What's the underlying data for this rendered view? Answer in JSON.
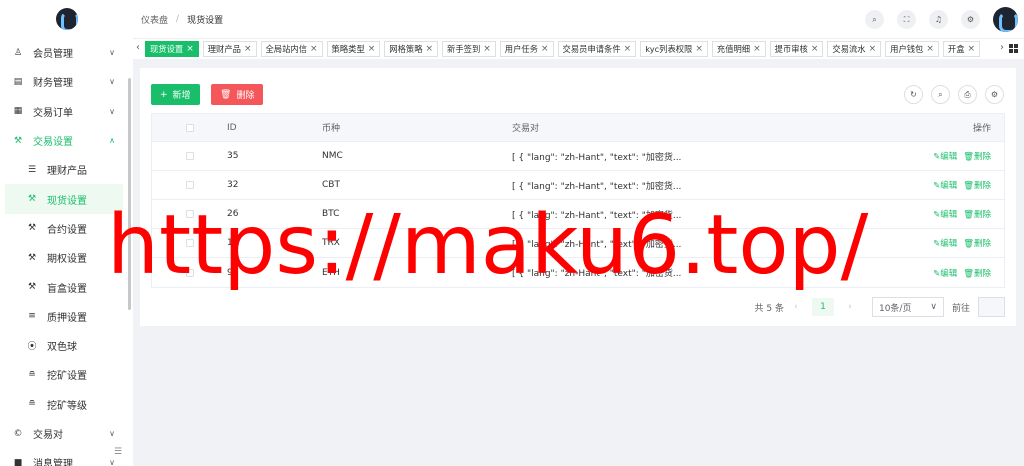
{
  "sidebar": {
    "logo": "logo-icon",
    "items": [
      {
        "icon": "user-icon",
        "glyph": "♙",
        "label": "会员管理",
        "arrow": "∨",
        "state": "closed",
        "sub": false
      },
      {
        "icon": "finance-icon",
        "glyph": "▤",
        "label": "财务管理",
        "arrow": "∨",
        "state": "closed",
        "sub": false
      },
      {
        "icon": "order-icon",
        "glyph": "▦",
        "label": "交易订单",
        "arrow": "∨",
        "state": "closed",
        "sub": false
      },
      {
        "icon": "wrench-icon",
        "glyph": "⚒",
        "label": "交易设置",
        "arrow": "∧",
        "state": "open",
        "sub": false
      },
      {
        "icon": "list-icon",
        "glyph": "☰",
        "label": "理财产品",
        "arrow": "",
        "state": "",
        "sub": true
      },
      {
        "icon": "wrench-icon",
        "glyph": "⚒",
        "label": "现货设置",
        "arrow": "",
        "state": "active",
        "sub": true
      },
      {
        "icon": "wrench-icon",
        "glyph": "⚒",
        "label": "合约设置",
        "arrow": "",
        "state": "",
        "sub": true
      },
      {
        "icon": "wrench-icon",
        "glyph": "⚒",
        "label": "期权设置",
        "arrow": "",
        "state": "",
        "sub": true
      },
      {
        "icon": "wrench-icon",
        "glyph": "⚒",
        "label": "盲盒设置",
        "arrow": "",
        "state": "",
        "sub": true
      },
      {
        "icon": "list-icon",
        "glyph": "≡",
        "label": "质押设置",
        "arrow": "",
        "state": "",
        "sub": true
      },
      {
        "icon": "target-icon",
        "glyph": "⦿",
        "label": "双色球",
        "arrow": "",
        "state": "",
        "sub": true
      },
      {
        "icon": "filter-icon",
        "glyph": "≘",
        "label": "挖矿设置",
        "arrow": "",
        "state": "",
        "sub": true
      },
      {
        "icon": "filter-icon",
        "glyph": "≘",
        "label": "挖矿等级",
        "arrow": "",
        "state": "",
        "sub": true
      },
      {
        "icon": "copyright-icon",
        "glyph": "©",
        "label": "交易对",
        "arrow": "∨",
        "state": "closed",
        "sub": false
      },
      {
        "icon": "message-icon",
        "glyph": "■",
        "label": "消息管理",
        "arrow": "∨",
        "state": "closed",
        "sub": false
      }
    ],
    "collapse_glyph": "☰"
  },
  "header": {
    "breadcrumb": [
      "仪表盘",
      "现货设置"
    ],
    "breadcrumb_sep": "/",
    "icons": [
      {
        "name": "search-icon",
        "glyph": "⌕"
      },
      {
        "name": "fullscreen-icon",
        "glyph": "⛶"
      },
      {
        "name": "bell-icon",
        "glyph": "♫"
      },
      {
        "name": "settings-icon",
        "glyph": "⚙"
      }
    ]
  },
  "tabs": {
    "prev": "‹",
    "next": "›",
    "close": "×",
    "items": [
      {
        "label": "现货设置",
        "active": true
      },
      {
        "label": "理财产品",
        "active": false
      },
      {
        "label": "全局站内信",
        "active": false
      },
      {
        "label": "策略类型",
        "active": false
      },
      {
        "label": "网格策略",
        "active": false
      },
      {
        "label": "新手签到",
        "active": false
      },
      {
        "label": "用户任务",
        "active": false
      },
      {
        "label": "交易员申请条件",
        "active": false
      },
      {
        "label": "kyc列表权限",
        "active": false
      },
      {
        "label": "充值明细",
        "active": false
      },
      {
        "label": "提币审核",
        "active": false
      },
      {
        "label": "交易流水",
        "active": false
      },
      {
        "label": "用户钱包",
        "active": false
      },
      {
        "label": "开盒",
        "active": false
      }
    ]
  },
  "toolbar": {
    "add_label": "新增",
    "add_glyph": "+",
    "delete_label": "删除",
    "delete_glyph": "🗑",
    "tools": [
      {
        "name": "refresh-icon",
        "glyph": "↻"
      },
      {
        "name": "search-icon",
        "glyph": "⌕"
      },
      {
        "name": "print-icon",
        "glyph": "⎙"
      },
      {
        "name": "settings-icon",
        "glyph": "⚙"
      }
    ]
  },
  "table": {
    "headers": {
      "id": "ID",
      "coin": "币种",
      "pair": "交易对",
      "op": "操作"
    },
    "rows": [
      {
        "id": "35",
        "coin": "NMC",
        "pair": "[ { \"lang\": \"zh-Hant\", \"text\": \"加密货..."
      },
      {
        "id": "32",
        "coin": "CBT",
        "pair": "[ { \"lang\": \"zh-Hant\", \"text\": \"加密货..."
      },
      {
        "id": "26",
        "coin": "BTC",
        "pair": "[ { \"lang\": \"zh-Hant\", \"text\": \"加密货..."
      },
      {
        "id": "10",
        "coin": "TRX",
        "pair": "[ { \"lang\": \"zh-Hant\", \"text\": \"加密货..."
      },
      {
        "id": "9",
        "coin": "ETH",
        "pair": "[ { \"lang\": \"zh-Hant\", \"text\": \"加密货..."
      }
    ],
    "edit_label": "✎编辑",
    "delete_label": "🗑删除"
  },
  "pagination": {
    "total": "共 5 条",
    "prev": "‹",
    "page": "1",
    "next": "›",
    "page_size": "10条/页",
    "size_arrow": "∨",
    "goto_label": "前往"
  },
  "watermark": "https://maku6.top/",
  "colors": {
    "accent": "#19be6b",
    "danger": "#f5565a",
    "watermark": "#ff0000"
  }
}
